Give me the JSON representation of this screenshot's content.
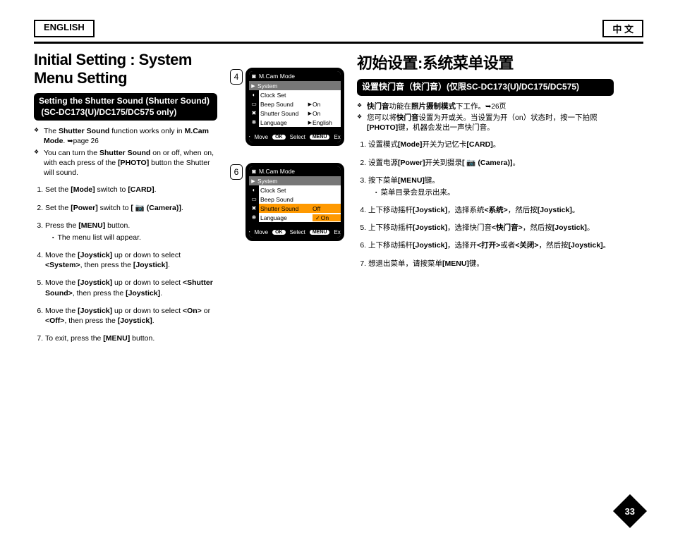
{
  "header": {
    "lang_left": "ENGLISH",
    "lang_right": "中  文"
  },
  "left": {
    "title": "Initial Setting : System Menu Setting",
    "subhead": "Setting the Shutter Sound (Shutter Sound)\n (SC-DC173(U)/DC175/DC575 only)",
    "note1_a": "The ",
    "note1_b": "Shutter Sound",
    "note1_c": " function works only in ",
    "note1_d": "M.Cam Mode",
    "note1_e": ". ",
    "note1_ref": "➥page 26",
    "note2_a": "You can turn the ",
    "note2_b": "Shutter Sound",
    "note2_c": " on or off, when on, with each press of the ",
    "note2_d": "[PHOTO]",
    "note2_e": " button the Shutter will sound.",
    "s1_a": "Set the ",
    "s1_b": "[Mode]",
    "s1_c": " switch to ",
    "s1_d": "[CARD]",
    "s1_e": ".",
    "s2_a": "Set the ",
    "s2_b": "[Power]",
    "s2_c": " switch to ",
    "s2_d": "[ 📷 (Camera)]",
    "s2_e": ".",
    "s3_a": "Press the ",
    "s3_b": "[MENU]",
    "s3_c": " button.",
    "s3_sub": "The menu list will appear.",
    "s4_a": "Move the ",
    "s4_b": "[Joystick]",
    "s4_c": " up or down to select ",
    "s4_d": "<System>",
    "s4_e": ", then press the ",
    "s4_f": "[Joystick]",
    "s4_g": ".",
    "s5_a": "Move the ",
    "s5_b": "[Joystick]",
    "s5_c": " up or down to select ",
    "s5_d": "<Shutter Sound>",
    "s5_e": ", then press the ",
    "s5_f": "[Joystick]",
    "s5_g": ".",
    "s6_a": "Move the ",
    "s6_b": "[Joystick]",
    "s6_c": " up or down to select ",
    "s6_d": "<On>",
    "s6_e": " or ",
    "s6_f": "<Off>",
    "s6_g": ", then press the ",
    "s6_h": "[Joystick]",
    "s6_i": ".",
    "s7_a": "To exit, press the ",
    "s7_b": "[MENU]",
    "s7_c": " button."
  },
  "fig": {
    "num4": "4",
    "num6": "6",
    "hdr": "M.Cam Mode",
    "system": "System",
    "r1": "Clock Set",
    "r2": "Beep Sound",
    "r3": "Shutter Sound",
    "r4": "Language",
    "v_on": "On",
    "v_off": "Off",
    "v_eng": "English",
    "f_move": "Move",
    "f_sel": "Select",
    "f_exit": "Exit",
    "f_ok": "OK",
    "f_menu": "MENU"
  },
  "right": {
    "title": "初始设置:系统菜单设置",
    "subhead": "设置快门音（快门音）(仅限SC-DC173(U)/DC175/DC575)",
    "n1_a": "快门音",
    "n1_b": "功能在",
    "n1_c": "照片摄制模式",
    "n1_d": "下工作。",
    "n1_ref": "➥26页",
    "n2_a": "您可以将",
    "n2_b": "快门音",
    "n2_c": "设置为开或关。当设置为开（on）状态时，按一下拍照",
    "n2_d": "[PHOTO]",
    "n2_e": "键，机器会发出一声快门音。",
    "s1_a": "设置模式",
    "s1_b": "[Mode]",
    "s1_c": "开关为记忆卡",
    "s1_d": "[CARD]",
    "s1_e": "。",
    "s2_a": "设置电源",
    "s2_b": "[Power]",
    "s2_c": "开关到摄录",
    "s2_d": "[ 📷 (Camera)]",
    "s2_e": "。",
    "s3_a": "按下菜单",
    "s3_b": "[MENU]",
    "s3_c": "键。",
    "s3_sub": "菜单目录会显示出来。",
    "s4_a": "上下移动摇杆",
    "s4_b": "[Joystick]",
    "s4_c": "，选择系统",
    "s4_d": "<系统>",
    "s4_e": "，然后按",
    "s4_f": "[Joystick]",
    "s4_g": "。",
    "s5_a": "上下移动摇杆",
    "s5_b": "[Joystick]",
    "s5_c": "，选择快门音",
    "s5_d": "<快门音>",
    "s5_e": "，然后按",
    "s5_f": "[Joystick]",
    "s5_g": "。",
    "s6_a": "上下移动摇杆",
    "s6_b": "[Joystick]",
    "s6_c": "，选择开",
    "s6_d": "<打开>",
    "s6_e": "或者",
    "s6_f": "<关闭>",
    "s6_g": "，然后按",
    "s6_h": "[Joystick]",
    "s6_i": "。",
    "s7_a": "想退出菜单，请按菜单",
    "s7_b": "[MENU]",
    "s7_c": "键。"
  },
  "pagenum": "33"
}
